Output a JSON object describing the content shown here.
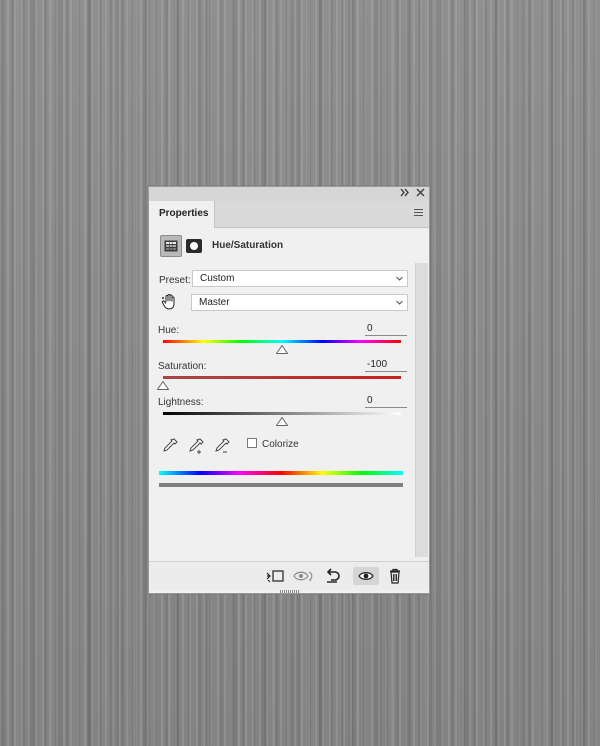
{
  "panel": {
    "title_bar": {
      "collapse_icon": "double-chevron-right-icon",
      "close_icon": "close-icon"
    },
    "tab_label": "Properties",
    "menu_icon": "panel-menu-icon",
    "header": {
      "adjustment_icon": "hue-saturation-adjustment-icon",
      "mask_icon": "layer-mask-icon",
      "title": "Hue/Saturation"
    }
  },
  "preset": {
    "label": "Preset:",
    "value": "Custom"
  },
  "channel": {
    "hand_tool_icon": "targeted-adjustment-hand-icon",
    "value": "Master"
  },
  "sliders": {
    "hue": {
      "label": "Hue:",
      "value": "0",
      "position_fraction": 0.5
    },
    "saturation": {
      "label": "Saturation:",
      "value": "-100",
      "position_fraction": 0.0
    },
    "lightness": {
      "label": "Lightness:",
      "value": "0",
      "position_fraction": 0.5
    }
  },
  "tools": {
    "eyedropper_icon": "eyedropper-icon",
    "eyedropper_add_icon": "eyedropper-plus-icon",
    "eyedropper_subtract_icon": "eyedropper-minus-icon",
    "colorize_label": "Colorize",
    "colorize_checked": false
  },
  "footer": {
    "clip_icon": "clip-to-layer-icon",
    "view_previous_icon": "view-previous-state-icon",
    "reset_icon": "reset-icon",
    "visibility_icon": "eye-icon",
    "delete_icon": "trash-icon"
  },
  "colors": {
    "panel_bg": "#f0f0f0",
    "saturation_bar": "#cc1f1f",
    "gray_bar": "#7f7f7f"
  }
}
